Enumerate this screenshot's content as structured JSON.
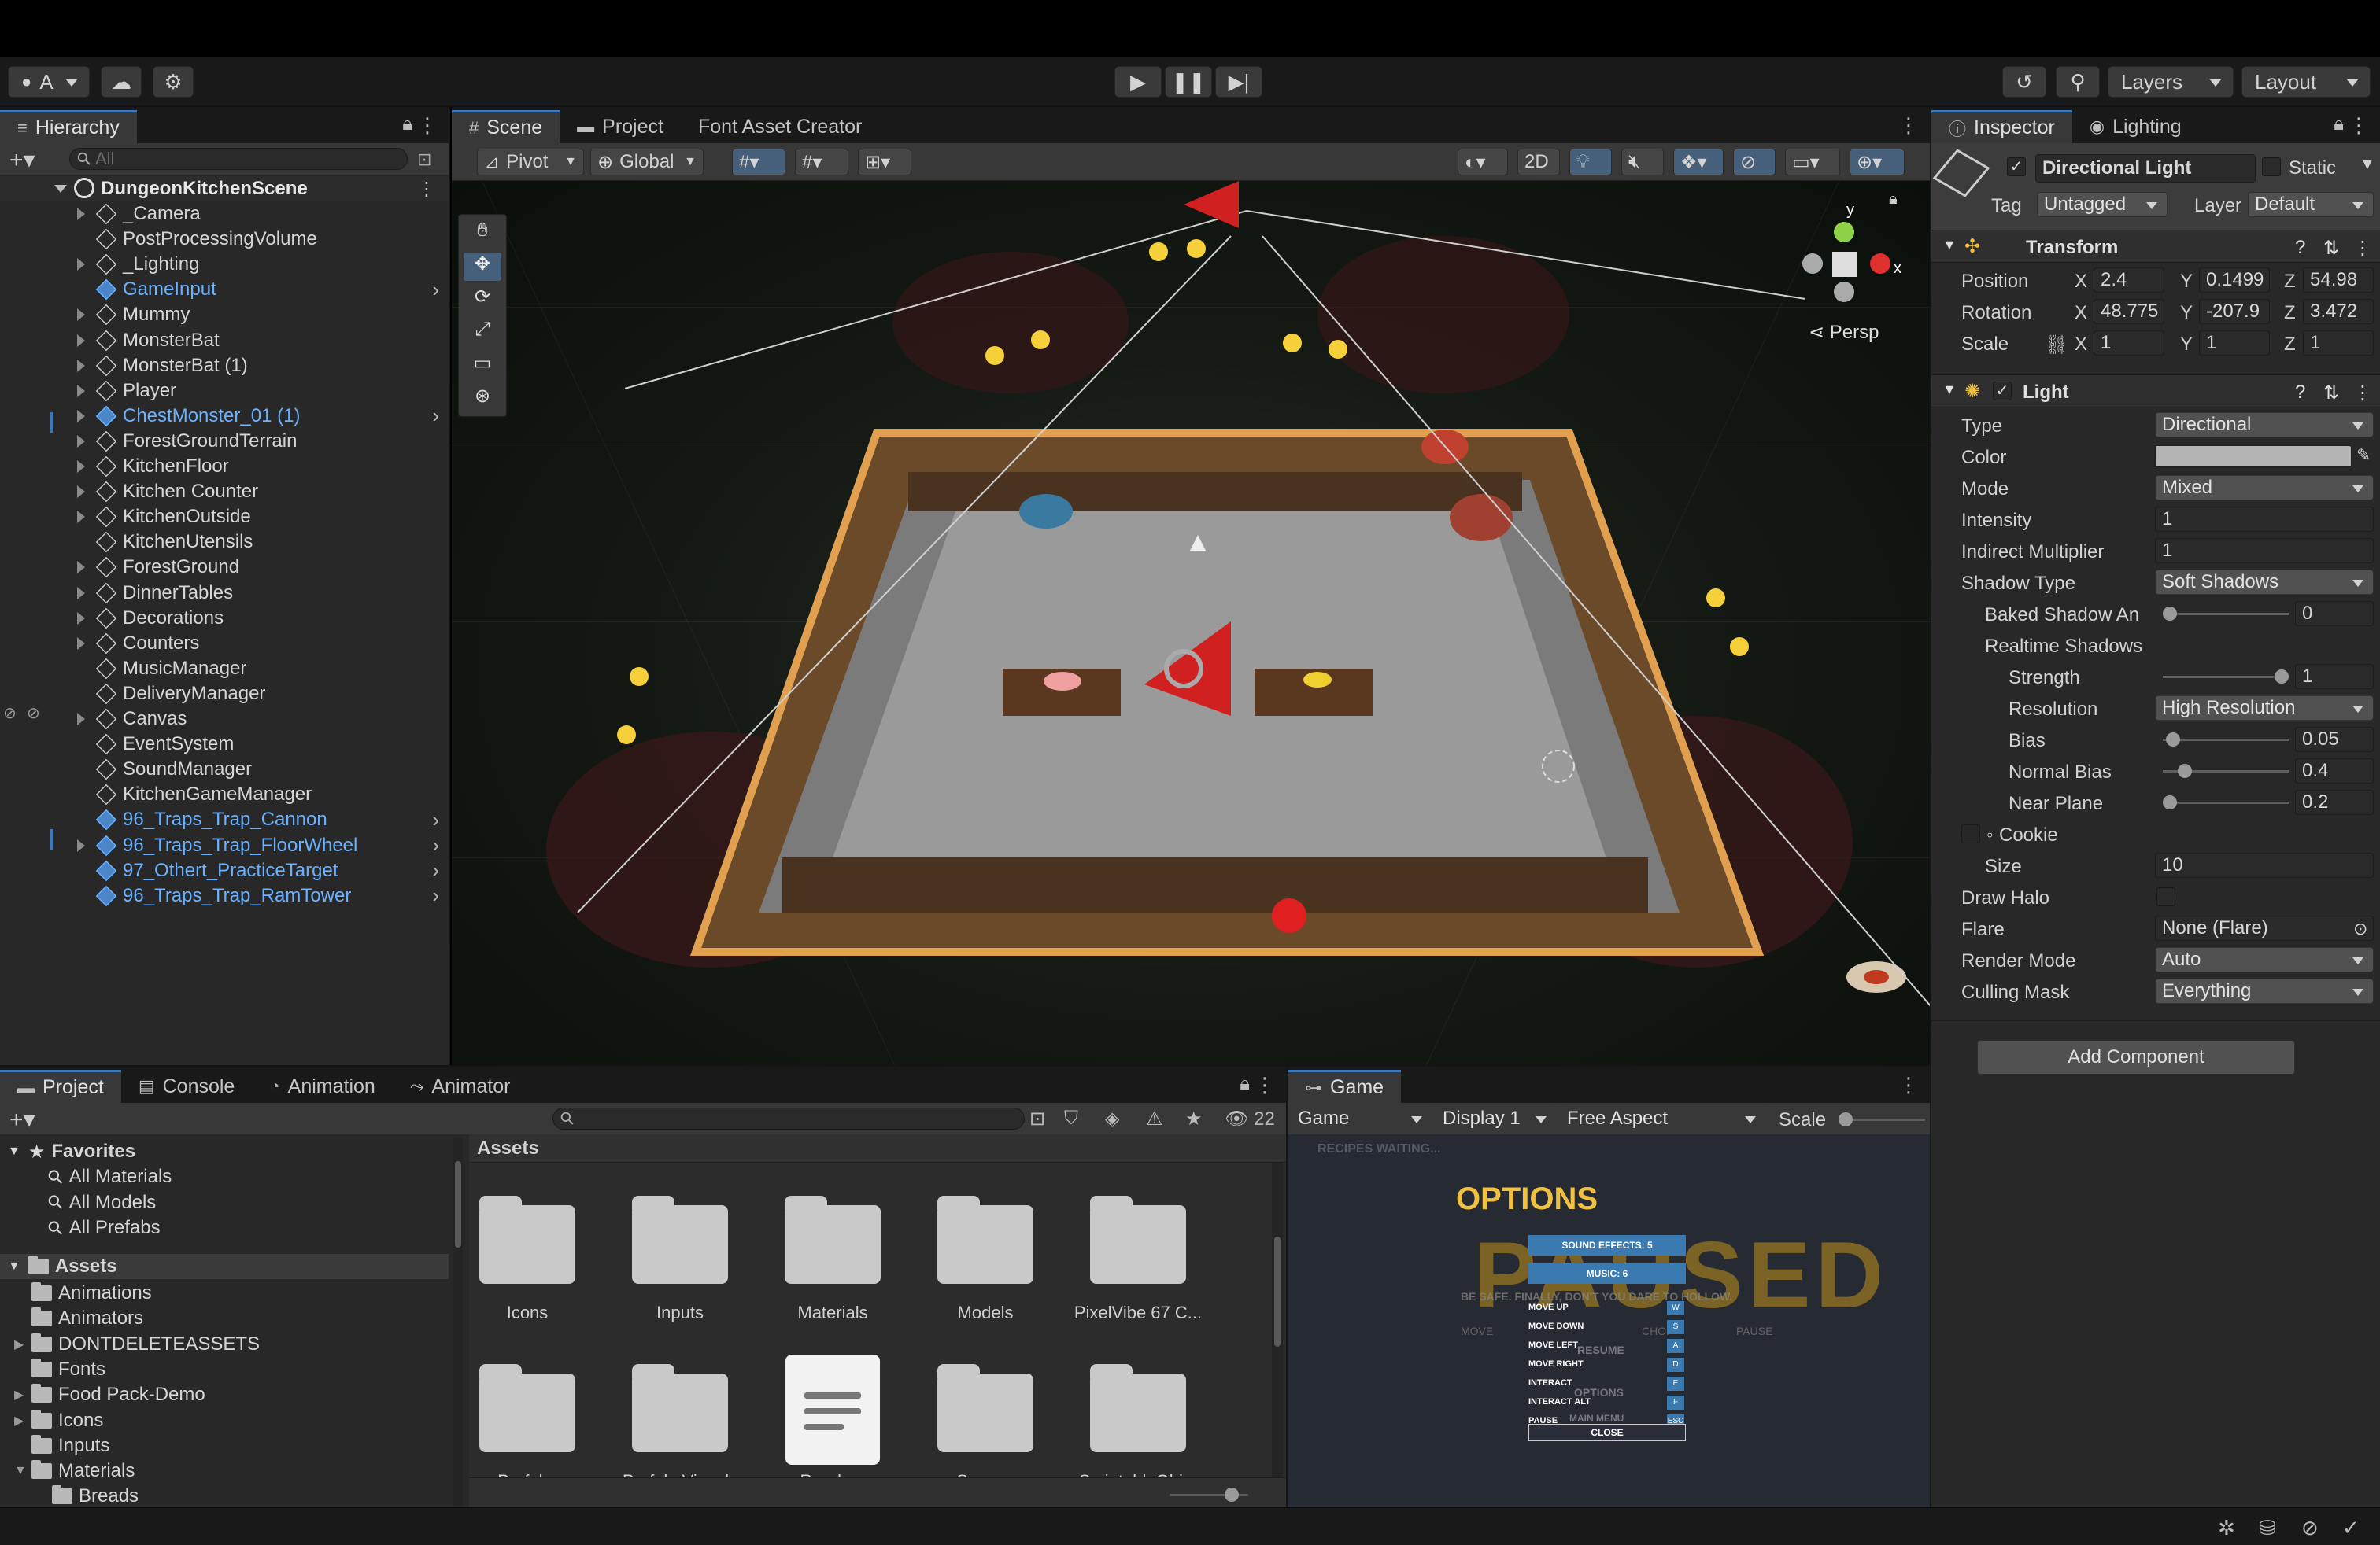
{
  "toolbar": {
    "account_label": "A",
    "layers_label": "Layers",
    "layout_label": "Layout"
  },
  "hierarchy": {
    "tab_label": "Hierarchy",
    "search_placeholder": "All",
    "scene_name": "DungeonKitchenScene",
    "items": [
      {
        "label": "_Camera",
        "expandable": true,
        "prefab": false
      },
      {
        "label": "PostProcessingVolume",
        "expandable": false,
        "prefab": false
      },
      {
        "label": "_Lighting",
        "expandable": true,
        "prefab": false
      },
      {
        "label": "GameInput",
        "expandable": false,
        "prefab": true
      },
      {
        "label": "Mummy",
        "expandable": true,
        "prefab": false
      },
      {
        "label": "MonsterBat",
        "expandable": true,
        "prefab": false
      },
      {
        "label": "MonsterBat (1)",
        "expandable": true,
        "prefab": false
      },
      {
        "label": "Player",
        "expandable": true,
        "prefab": false
      },
      {
        "label": "ChestMonster_01 (1)",
        "expandable": true,
        "prefab": true
      },
      {
        "label": "ForestGroundTerrain",
        "expandable": true,
        "prefab": false
      },
      {
        "label": "KitchenFloor",
        "expandable": true,
        "prefab": false
      },
      {
        "label": "Kitchen Counter",
        "expandable": true,
        "prefab": false
      },
      {
        "label": "KitchenOutside",
        "expandable": true,
        "prefab": false
      },
      {
        "label": "KitchenUtensils",
        "expandable": false,
        "prefab": false
      },
      {
        "label": "ForestGround",
        "expandable": true,
        "prefab": false
      },
      {
        "label": "DinnerTables",
        "expandable": true,
        "prefab": false
      },
      {
        "label": "Decorations",
        "expandable": true,
        "prefab": false
      },
      {
        "label": "Counters",
        "expandable": true,
        "prefab": false
      },
      {
        "label": "MusicManager",
        "expandable": false,
        "prefab": false
      },
      {
        "label": "DeliveryManager",
        "expandable": false,
        "prefab": false
      },
      {
        "label": "Canvas",
        "expandable": true,
        "prefab": false
      },
      {
        "label": "EventSystem",
        "expandable": false,
        "prefab": false
      },
      {
        "label": "SoundManager",
        "expandable": false,
        "prefab": false
      },
      {
        "label": "KitchenGameManager",
        "expandable": false,
        "prefab": false
      },
      {
        "label": "96_Traps_Trap_Cannon",
        "expandable": false,
        "prefab": true
      },
      {
        "label": "96_Traps_Trap_FloorWheel",
        "expandable": true,
        "prefab": true
      },
      {
        "label": "97_Othert_PracticeTarget",
        "expandable": false,
        "prefab": true
      },
      {
        "label": "96_Traps_Trap_RamTower",
        "expandable": false,
        "prefab": true
      }
    ]
  },
  "scene_view": {
    "tabs": [
      "Scene",
      "Project",
      "Font Asset Creator"
    ],
    "pivot_label": "Pivot",
    "global_label": "Global",
    "mode_2d": "2D",
    "persp_label": "Persp",
    "gizmo_y": "y",
    "gizmo_x": "x"
  },
  "inspector": {
    "tabs": [
      "Inspector",
      "Lighting"
    ],
    "object_name": "Directional Light",
    "static_label": "Static",
    "tag_label": "Tag",
    "tag_value": "Untagged",
    "layer_label": "Layer",
    "layer_value": "Default",
    "transform": {
      "title": "Transform",
      "position_label": "Position",
      "rotation_label": "Rotation",
      "scale_label": "Scale",
      "position": {
        "x": "2.4",
        "y": "0.1499",
        "z": "54.98"
      },
      "rotation": {
        "x": "48.775",
        "y": "-207.9",
        "z": "3.472"
      },
      "scale": {
        "x": "1",
        "y": "1",
        "z": "1"
      }
    },
    "light": {
      "title": "Light",
      "type_label": "Type",
      "type_value": "Directional",
      "color_label": "Color",
      "mode_label": "Mode",
      "mode_value": "Mixed",
      "intensity_label": "Intensity",
      "intensity_value": "1",
      "indirect_label": "Indirect Multiplier",
      "indirect_value": "1",
      "shadow_type_label": "Shadow Type",
      "shadow_type_value": "Soft Shadows",
      "baked_label": "Baked Shadow An",
      "baked_value": "0",
      "baked_level": 0,
      "realtime_label": "Realtime Shadows",
      "strength_label": "Strength",
      "strength_value": "1",
      "strength_level": 1,
      "resolution_label": "Resolution",
      "resolution_value": "High Resolution",
      "bias_label": "Bias",
      "bias_value": "0.05",
      "bias_level": 0.025,
      "normal_bias_label": "Normal Bias",
      "normal_bias_value": "0.4",
      "normal_bias_level": 0.133,
      "near_plane_label": "Near Plane",
      "near_plane_value": "0.2",
      "near_plane_level": 0.0,
      "cookie_label": "Cookie",
      "size_label": "Size",
      "size_value": "10",
      "draw_halo_label": "Draw Halo",
      "flare_label": "Flare",
      "flare_value": "None (Flare)",
      "render_mode_label": "Render Mode",
      "render_mode_value": "Auto",
      "culling_label": "Culling Mask",
      "culling_value": "Everything"
    },
    "add_component_label": "Add Component",
    "color_swatch": "#b4b4b4"
  },
  "project": {
    "tabs": [
      "Project",
      "Console",
      "Animation",
      "Animator"
    ],
    "favorites_label": "Favorites",
    "favorites": [
      "All Materials",
      "All Models",
      "All Prefabs"
    ],
    "assets_label": "Assets",
    "tree": [
      {
        "label": "Animations",
        "expandable": false,
        "indent": 1
      },
      {
        "label": "Animators",
        "expandable": false,
        "indent": 1
      },
      {
        "label": "DONTDELETEASSETS",
        "expandable": true,
        "indent": 1
      },
      {
        "label": "Fonts",
        "expandable": false,
        "indent": 1
      },
      {
        "label": "Food Pack-Demo",
        "expandable": true,
        "indent": 1
      },
      {
        "label": "Icons",
        "expandable": true,
        "indent": 1
      },
      {
        "label": "Inputs",
        "expandable": false,
        "indent": 1
      },
      {
        "label": "Materials",
        "expandable": true,
        "indent": 1
      },
      {
        "label": "Breads",
        "expandable": false,
        "indent": 2
      }
    ],
    "breadcrumb": "Assets",
    "hidden_count": "22",
    "grid": [
      {
        "label": "Icons",
        "kind": "folder"
      },
      {
        "label": "Inputs",
        "kind": "folder"
      },
      {
        "label": "Materials",
        "kind": "folder"
      },
      {
        "label": "Models",
        "kind": "folder"
      },
      {
        "label": "PixelVibe 67 C...",
        "kind": "folder"
      },
      {
        "label": "Prefabs",
        "kind": "folder"
      },
      {
        "label": "PrefabsVisuals",
        "kind": "folder"
      },
      {
        "label": "Readme",
        "kind": "doc"
      },
      {
        "label": "Scenes",
        "kind": "folder"
      },
      {
        "label": "ScriptableObj...",
        "kind": "folder"
      }
    ]
  },
  "game": {
    "tab_label": "Game",
    "display_mode": "Game",
    "display": "Display 1",
    "aspect": "Free Aspect",
    "scale_label": "Scale",
    "ui": {
      "recipes": "RECIPES WAITING...",
      "options_title": "OPTIONS",
      "paused_bg": "PAUSED",
      "sound_effects": "SOUND EFFECTS: 5",
      "music": "MUSIC: 6",
      "warning": "BE SAFE. FINALLY, DON'T YOU DARE TO HOLLOW.",
      "move_label": "MOVE",
      "chop_label": "CHOP",
      "pause_label": "PAUSE",
      "bindings": [
        {
          "action": "MOVE UP",
          "key": "W"
        },
        {
          "action": "MOVE DOWN",
          "key": "S"
        },
        {
          "action": "MOVE LEFT",
          "key": "A"
        },
        {
          "action": "MOVE RIGHT",
          "key": "D"
        },
        {
          "action": "INTERACT",
          "key": "E"
        },
        {
          "action": "INTERACT ALT",
          "key": "F"
        },
        {
          "action": "PAUSE",
          "key": "ESC"
        }
      ],
      "resume": "RESUME",
      "options_btn": "OPTIONS",
      "main_menu": "MAIN MENU",
      "close": "CLOSE"
    }
  }
}
